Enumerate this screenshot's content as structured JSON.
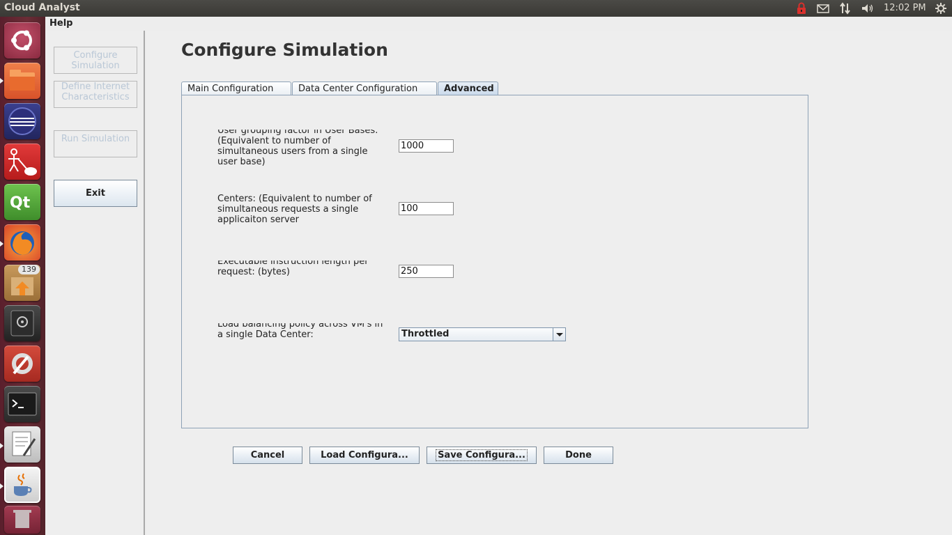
{
  "system": {
    "app_title": "Cloud Analyst",
    "clock": "12:02 PM",
    "tray_icons": [
      "lock-icon",
      "mail-icon",
      "network-icon",
      "volume-icon",
      "settings-gear-icon"
    ]
  },
  "launcher": {
    "items": [
      {
        "name": "ubuntu-dash-icon"
      },
      {
        "name": "files-icon"
      },
      {
        "name": "eclipse-icon"
      },
      {
        "name": "uml-tool-icon"
      },
      {
        "name": "qt-creator-icon"
      },
      {
        "name": "firefox-icon"
      },
      {
        "name": "software-updater-icon",
        "badge": "139"
      },
      {
        "name": "disk-icon"
      },
      {
        "name": "system-settings-icon"
      },
      {
        "name": "terminal-icon"
      },
      {
        "name": "text-editor-icon"
      },
      {
        "name": "java-icon"
      },
      {
        "name": "trash-icon"
      }
    ]
  },
  "menu": {
    "help": "Help"
  },
  "sidebar": {
    "configure_simulation": "Configure Simulation",
    "define_internet": "Define Internet Characteristics",
    "run_simulation": "Run Simulation",
    "exit": "Exit"
  },
  "page": {
    "title": "Configure Simulation",
    "tabs": [
      {
        "label": "Main Configuration"
      },
      {
        "label": "Data Center Configuration"
      },
      {
        "label": "Advanced"
      }
    ]
  },
  "advanced": {
    "user_grouping": {
      "label": "User grouping factor in User Bases: (Equivalent to number of simultaneous users from a single user base)",
      "value": "1000"
    },
    "request_grouping": {
      "label": "Request grouping factor in Data Centers: (Equivalent to number of simultaneous requests a single applicaiton server",
      "value": "100"
    },
    "instruction_length": {
      "label": "Executable instruction length per request: (bytes)",
      "value": "250"
    },
    "load_balancing": {
      "label": "Load balancing policy across VM's in a single Data Center:",
      "value": "Throttled"
    }
  },
  "buttons": {
    "cancel": "Cancel",
    "load": "Load Configura...",
    "save": "Save Configura...",
    "done": "Done"
  }
}
